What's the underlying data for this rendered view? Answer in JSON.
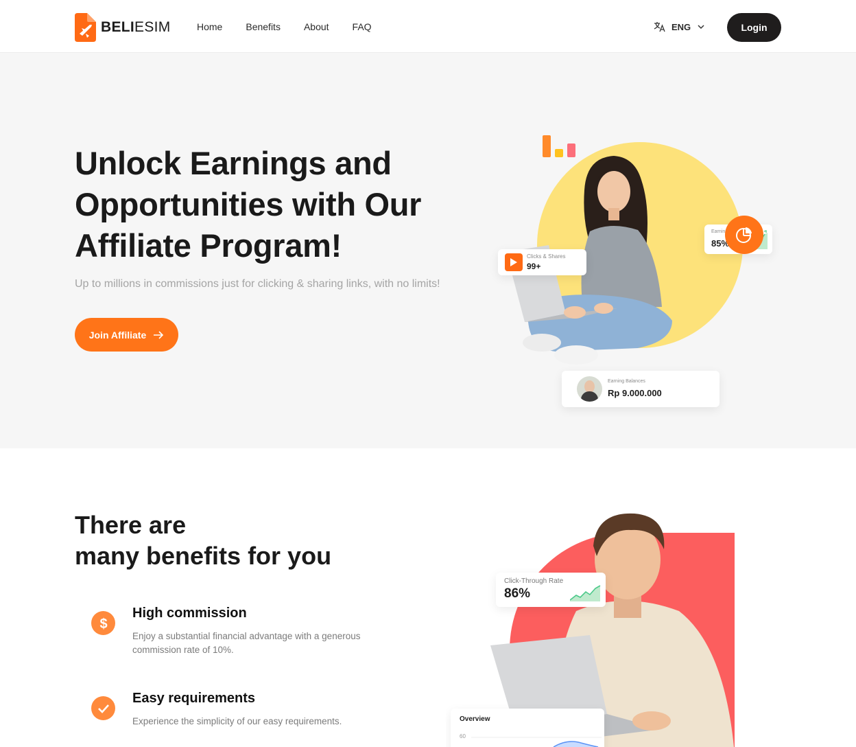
{
  "brand": {
    "name_bold": "BELI",
    "name_light": "ESIM"
  },
  "nav": {
    "items": [
      {
        "label": "Home"
      },
      {
        "label": "Benefits"
      },
      {
        "label": "About"
      },
      {
        "label": "FAQ"
      }
    ]
  },
  "language": {
    "selected": "ENG"
  },
  "header": {
    "login_label": "Login"
  },
  "hero": {
    "title": "Unlock Earnings and Opportunities with Our Affiliate Program!",
    "subtitle": "Up to millions in commissions just for clicking & sharing links, with no limits!",
    "join_label": "Join Affiliate",
    "cards": {
      "clicks_label": "Clicks & Shares",
      "clicks_value": "99+",
      "earnings_label": "Earnings",
      "earnings_value": "85%",
      "balance_label": "Earning Balances",
      "balance_value": "Rp 9.000.000"
    }
  },
  "benefits": {
    "title_line1": "There are",
    "title_line2": "many benefits for you",
    "items": [
      {
        "title": "High commission",
        "desc": "Enjoy a substantial financial advantage with a generous commission rate of 10%.",
        "icon": "dollar-icon"
      },
      {
        "title": "Easy requirements",
        "desc": "Experience the simplicity of our easy requirements.",
        "icon": "check-icon"
      }
    ],
    "ctr_label": "Click-Through Rate",
    "ctr_value": "86%",
    "overview_label": "Overview",
    "overview_tick": "60"
  },
  "colors": {
    "accent": "#ff7418",
    "dark": "#1f1d1d",
    "yellow": "#fde27a",
    "red": "#fc5e5e",
    "green": "#4cc98a"
  }
}
